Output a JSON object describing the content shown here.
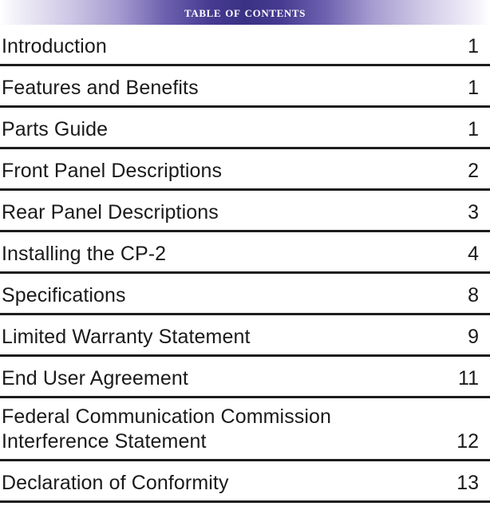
{
  "document": {
    "type": "table-of-contents",
    "banner": {
      "title": "Table Of Contents",
      "gradient_edge_color": "#ffffff",
      "gradient_mid_color": "#a79cd0",
      "gradient_center_color": "#3b3184",
      "title_color": "#ffffff"
    },
    "rule_color": "#1d1d1d",
    "text_color": "#1a1a1a",
    "entries": [
      {
        "title": "Introduction",
        "page": "1",
        "lines": 1
      },
      {
        "title": "Features and Benefits",
        "page": "1",
        "lines": 1
      },
      {
        "title": "Parts Guide",
        "page": "1",
        "lines": 1
      },
      {
        "title": "Front Panel Descriptions",
        "page": "2",
        "lines": 1
      },
      {
        "title": "Rear Panel Descriptions",
        "page": "3",
        "lines": 1
      },
      {
        "title": "Installing the CP-2",
        "page": "4",
        "lines": 1
      },
      {
        "title": "Specifications",
        "page": "8",
        "lines": 1
      },
      {
        "title": "Limited Warranty Statement",
        "page": "9",
        "lines": 1
      },
      {
        "title": "End User Agreement",
        "page": "11",
        "lines": 1
      },
      {
        "title": "Federal Communication Commission\nInterference Statement",
        "page": "12",
        "lines": 2
      },
      {
        "title": "Declaration of Conformity",
        "page": "13",
        "lines": 1
      }
    ]
  }
}
